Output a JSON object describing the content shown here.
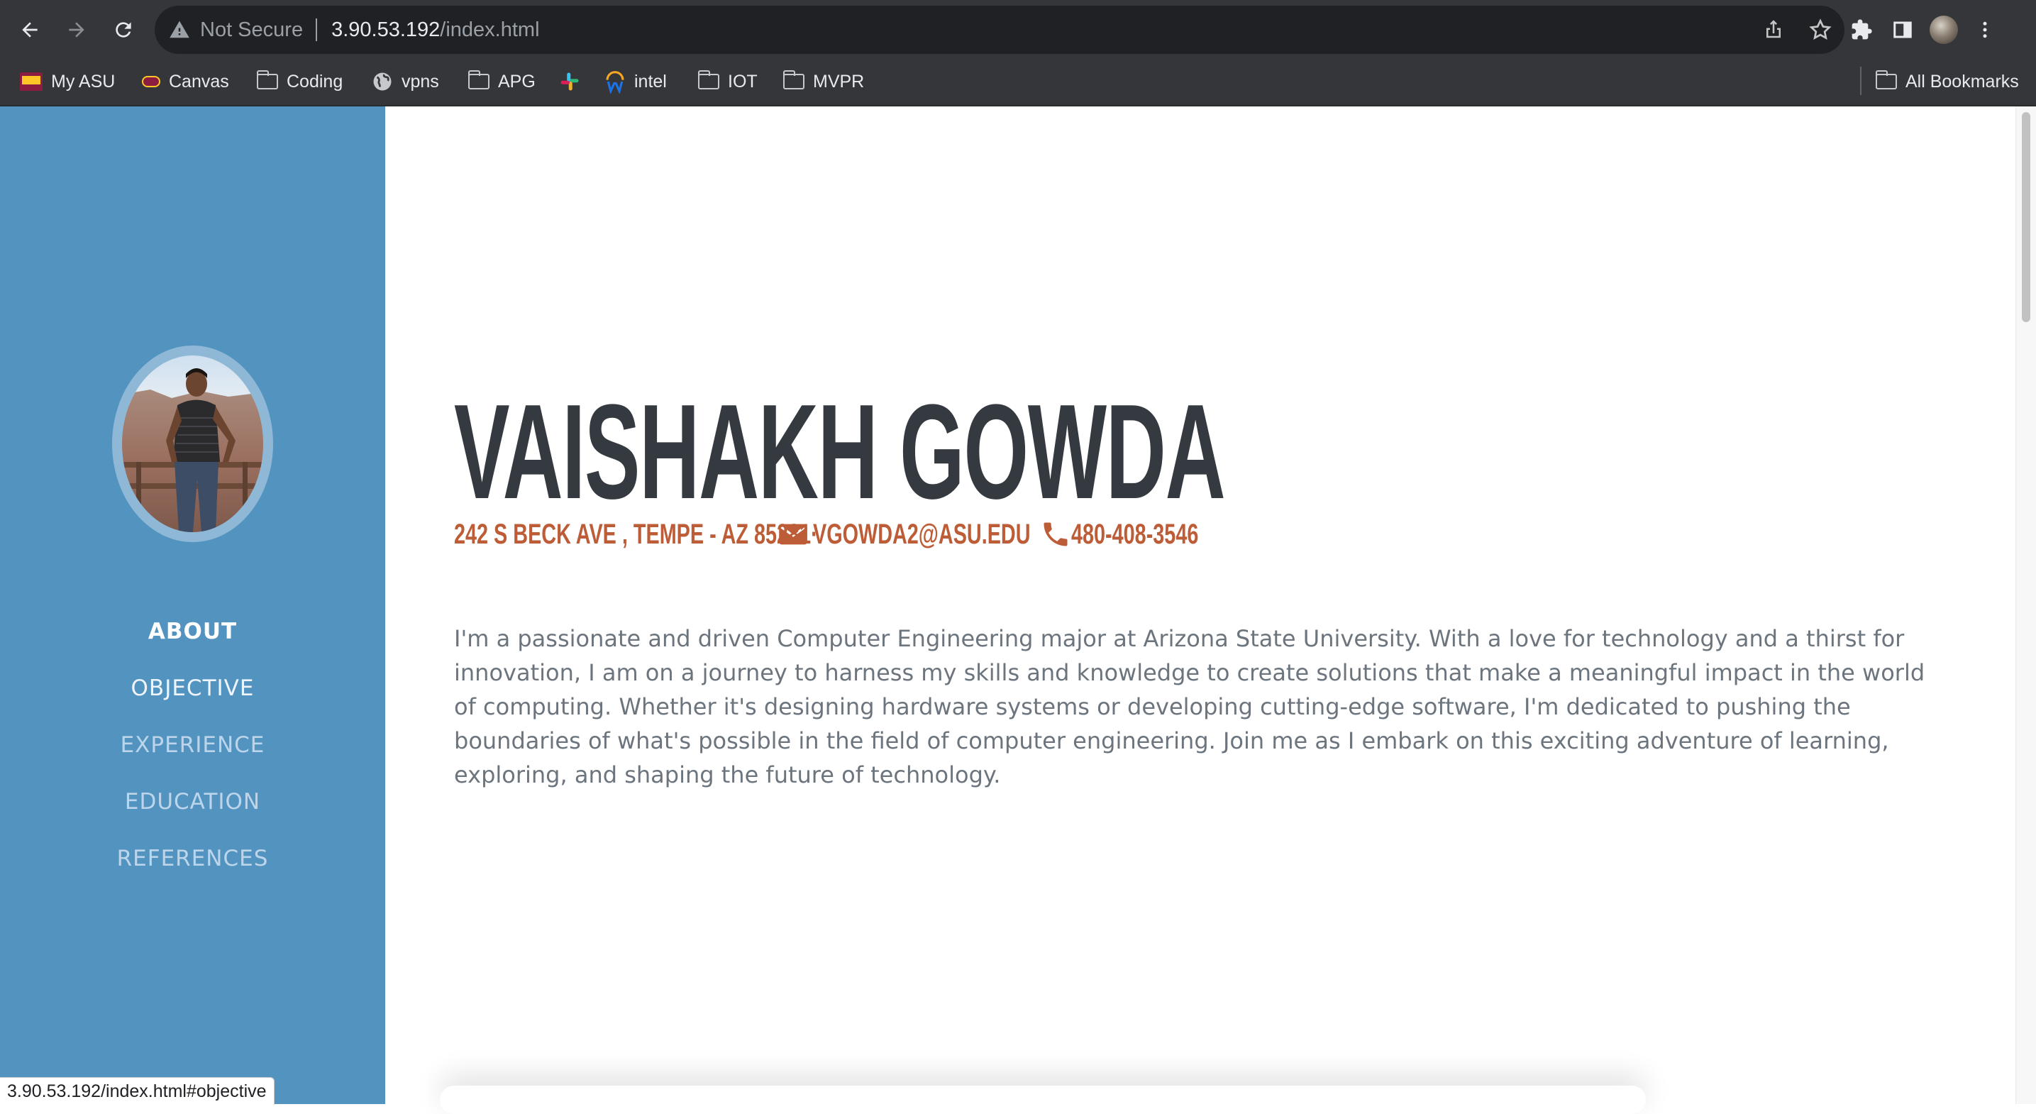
{
  "browser": {
    "security_label": "Not Secure",
    "url_host": "3.90.53.192",
    "url_path": "/index.html",
    "bookmarks": [
      {
        "label": "My ASU",
        "icon": "asu-favicon"
      },
      {
        "label": "Canvas",
        "icon": "canvas-favicon"
      },
      {
        "label": "Coding",
        "icon": "folder-icon"
      },
      {
        "label": "vpns",
        "icon": "globe-icon"
      },
      {
        "label": "APG",
        "icon": "folder-icon"
      },
      {
        "label": "",
        "icon": "slack-favicon"
      },
      {
        "label": "intel",
        "icon": "workday-favicon"
      },
      {
        "label": "IOT",
        "icon": "folder-icon"
      },
      {
        "label": "MVPR",
        "icon": "folder-icon"
      }
    ],
    "all_bookmarks_label": "All Bookmarks",
    "status_url": "3.90.53.192/index.html#objective"
  },
  "sidebar": {
    "nav": [
      {
        "label": "ABOUT",
        "state": "active",
        "color": "#ffffff"
      },
      {
        "label": "OBJECTIVE",
        "state": "hover",
        "color": "#eef4fa"
      },
      {
        "label": "EXPERIENCE",
        "state": "normal",
        "color": "#bcd5ea"
      },
      {
        "label": "EDUCATION",
        "state": "normal",
        "color": "#bcd5ea"
      },
      {
        "label": "REFERENCES",
        "state": "normal",
        "color": "#bcd5ea"
      }
    ]
  },
  "about": {
    "name": "VAISHAKH GOWDA",
    "address": "242 S BECK AVE , TEMPE - AZ 85281·",
    "email": "VGOWDA2@ASU.EDU",
    "phone": "480-408-3546",
    "lead": "I'm a passionate and driven Computer Engineering major at Arizona State University. With a love for technology and a thirst for innovation, I am on a journey to harness my skills and knowledge to create solutions that make a meaningful impact in the world of computing. Whether it's designing hardware systems or developing cutting-edge software, I'm dedicated to pushing the boundaries of what's possible in the field of computer engineering. Join me as I embark on this exciting adventure of learning, exploring, and shaping the future of technology."
  },
  "colors": {
    "sidebar_bg": "#5293c0",
    "accent": "#bd5d38",
    "heading": "#343a40",
    "body_text": "#6c757d",
    "chrome_bg": "#35363a"
  }
}
